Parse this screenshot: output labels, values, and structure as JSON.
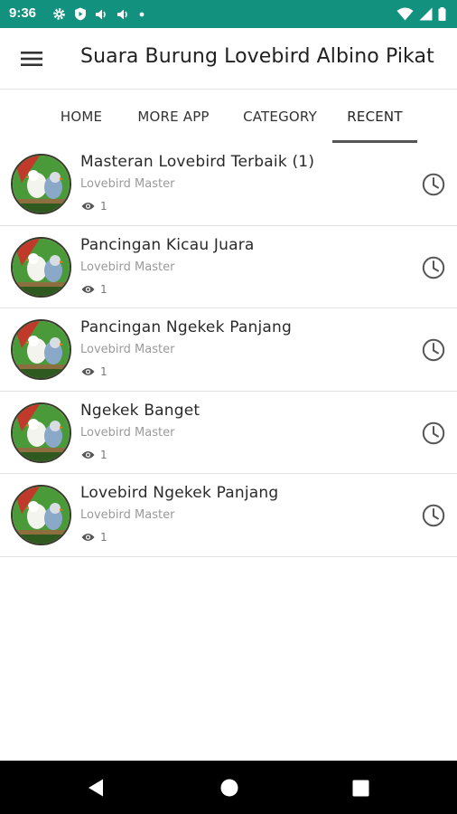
{
  "status_bar": {
    "time": "9:36",
    "left_icons": [
      "gear-icon",
      "shield-icon",
      "volume-icon",
      "volume-icon",
      "dot-icon"
    ],
    "right_icons": [
      "wifi-icon",
      "signal-icon",
      "battery-icon"
    ]
  },
  "app_bar": {
    "menu_icon": "hamburger-menu-icon",
    "title": "Suara Burung Lovebird Albino Pikat"
  },
  "tabs": [
    {
      "label": "HOME",
      "active": false
    },
    {
      "label": "MORE APP",
      "active": false
    },
    {
      "label": "CATEGORY",
      "active": false
    },
    {
      "label": "RECENT",
      "active": true
    }
  ],
  "items": [
    {
      "title": "Masteran Lovebird Terbaik (1)",
      "subtitle": "Lovebird Master",
      "views": "1"
    },
    {
      "title": "Pancingan Kicau Juara",
      "subtitle": "Lovebird Master",
      "views": "1"
    },
    {
      "title": "Pancingan Ngekek Panjang",
      "subtitle": "Lovebird Master",
      "views": "1"
    },
    {
      "title": "Ngekek Banget",
      "subtitle": "Lovebird Master",
      "views": "1"
    },
    {
      "title": "Lovebird Ngekek Panjang",
      "subtitle": "Lovebird Master",
      "views": "1"
    }
  ],
  "nav_bar": {
    "icons": [
      "back-icon",
      "home-icon",
      "recents-icon"
    ]
  },
  "colors": {
    "status_bar": "#13917f",
    "nav_bar": "#000000",
    "tab_indicator": "#555555"
  }
}
